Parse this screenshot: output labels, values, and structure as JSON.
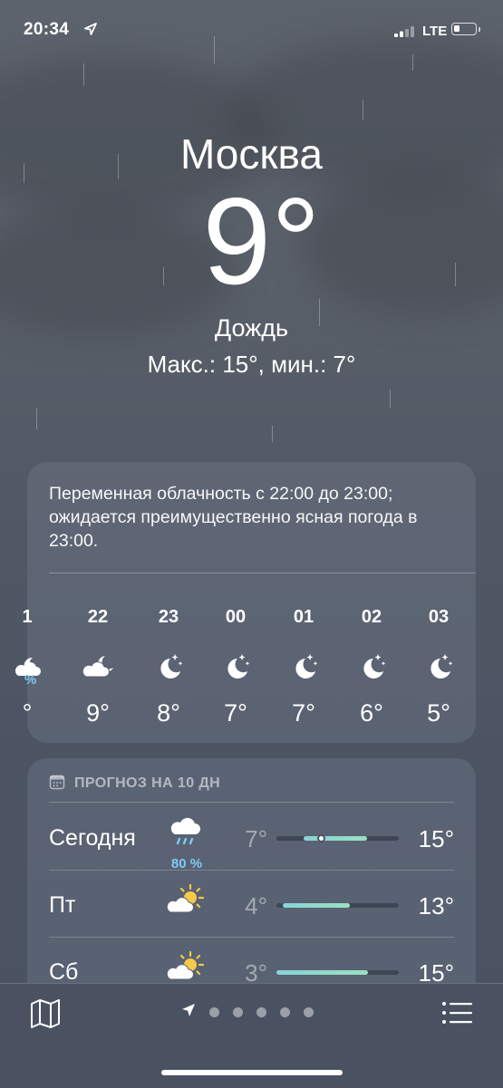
{
  "status_bar": {
    "time": "20:34",
    "network": "LTE",
    "battery_level": 0.3
  },
  "header": {
    "city": "Москва",
    "temperature": "9°",
    "condition": "Дождь",
    "high_low": "Макс.: 15°, мин.: 7°"
  },
  "hourly": {
    "summary": "Переменная облачность с 22:00 до 23:00; ожидается преимущественно ясная погода в 23:00.",
    "partial_time": "1",
    "partial_precip": "%",
    "partial_temp": "°",
    "items": [
      {
        "time": "22",
        "icon": "cloud-moon-icon",
        "temp": "9°"
      },
      {
        "time": "23",
        "icon": "moon-stars-icon",
        "temp": "8°"
      },
      {
        "time": "00",
        "icon": "moon-stars-icon",
        "temp": "7°"
      },
      {
        "time": "01",
        "icon": "moon-stars-icon",
        "temp": "7°"
      },
      {
        "time": "02",
        "icon": "moon-stars-icon",
        "temp": "6°"
      },
      {
        "time": "03",
        "icon": "moon-stars-icon",
        "temp": "5°"
      }
    ]
  },
  "daily": {
    "title": "ПРОГНОЗ НА 10 ДН",
    "days": [
      {
        "day": "Сегодня",
        "icon": "cloud-rain-icon",
        "precip": "80 %",
        "low": "7°",
        "high": "15°",
        "range_start": 0.22,
        "range_end": 0.74,
        "current": 0.36
      },
      {
        "day": "Пт",
        "icon": "sun-cloud-icon",
        "precip": "",
        "low": "4°",
        "high": "13°",
        "range_start": 0.05,
        "range_end": 0.6,
        "current": null
      },
      {
        "day": "Сб",
        "icon": "sun-cloud-icon",
        "precip": "",
        "low": "3°",
        "high": "15°",
        "range_start": 0.0,
        "range_end": 0.75,
        "current": null
      }
    ]
  },
  "toolbar": {
    "pages": 5,
    "active_page": 0
  },
  "colors": {
    "precip_blue": "#7ec9f5",
    "bar_start": "#86d3d9",
    "bar_end": "#9be0bf",
    "background": "#525965"
  }
}
